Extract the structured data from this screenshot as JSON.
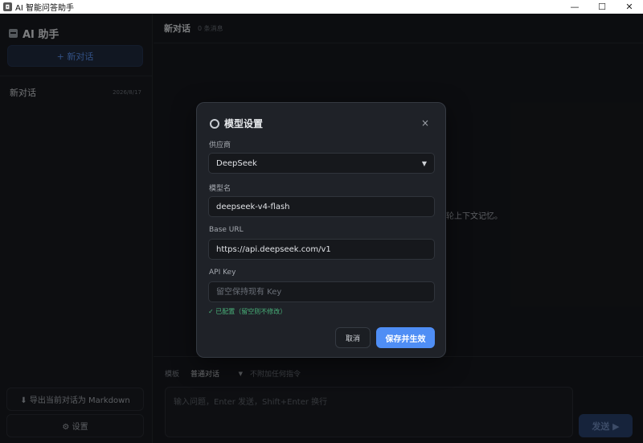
{
  "window": {
    "title": "AI 智能问答助手",
    "minimize": "—",
    "maximize": "☐",
    "close": "✕"
  },
  "sidebar": {
    "brand": "AI 助手",
    "new_chat": "+ 新对话",
    "conversations": [
      {
        "title": "新对话",
        "date": "2026/8/17"
      }
    ],
    "export_label": "⬇ 导出当前对话为 Markdown",
    "settings_label": "⚙ 设置"
  },
  "main": {
    "title": "新对话",
    "message_count": "0 条消息",
    "welcome_text": "支持多轮上下文记忆。",
    "template_label": "模板",
    "template_value": "普通对话",
    "template_hint": "不附加任何指令",
    "input_placeholder": "输入问题，Enter 发送，Shift+Enter 换行",
    "send_label": "发送 ▶"
  },
  "modal": {
    "title": "模型设置",
    "close": "×",
    "provider_label": "供应商",
    "provider_value": "DeepSeek",
    "model_label": "模型名",
    "model_value": "deepseek-v4-flash",
    "base_url_label": "Base URL",
    "base_url_value": "https://api.deepseek.com/v1",
    "api_key_label": "API Key",
    "api_key_placeholder": "留空保持现有 Key",
    "configured_text": "✓ 已配置（留空则不修改）",
    "cancel_label": "取消",
    "save_label": "保存并生效"
  },
  "colors": {
    "accent": "#4f8ef5",
    "success": "#49b27a",
    "background": "#16181d"
  }
}
